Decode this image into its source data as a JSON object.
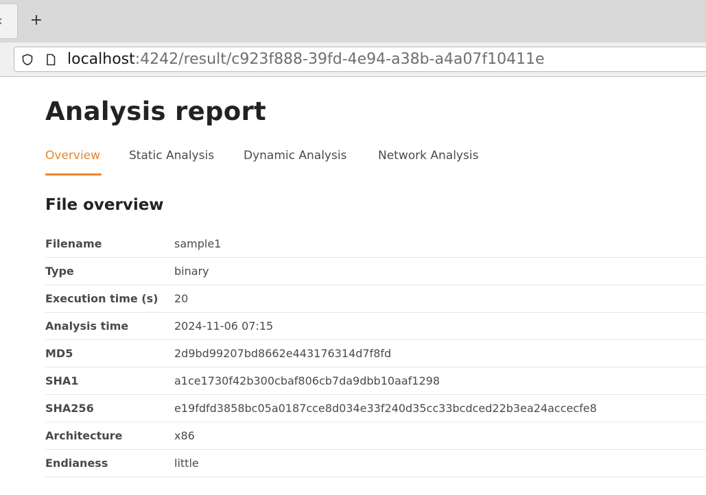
{
  "browser": {
    "tab_close_glyph": "×",
    "new_tab_glyph": "+",
    "url_host": "localhost",
    "url_path": ":4242/result/c923f888-39fd-4e94-a38b-a4a07f10411e",
    "icons": [
      "shield-icon",
      "page-icon",
      "close-icon",
      "plus-icon"
    ]
  },
  "page": {
    "title": "Analysis report",
    "tabs": [
      {
        "label": "Overview",
        "active": true
      },
      {
        "label": "Static Analysis",
        "active": false
      },
      {
        "label": "Dynamic Analysis",
        "active": false
      },
      {
        "label": "Network Analysis",
        "active": false
      }
    ],
    "accent_color": "#e8852b",
    "section_title": "File overview",
    "overview": [
      {
        "label": "Filename",
        "value": "sample1"
      },
      {
        "label": "Type",
        "value": "binary"
      },
      {
        "label": "Execution time (s)",
        "value": "20"
      },
      {
        "label": "Analysis time",
        "value": "2024-11-06 07:15"
      },
      {
        "label": "MD5",
        "value": "2d9bd99207bd8662e443176314d7f8fd"
      },
      {
        "label": "SHA1",
        "value": "a1ce1730f42b300cbaf806cb7da9dbb10aaf1298"
      },
      {
        "label": "SHA256",
        "value": "e19fdfd3858bc05a0187cce8d034e33f240d35cc33bcdced22b3ea24accecfe8"
      },
      {
        "label": "Architecture",
        "value": "x86"
      },
      {
        "label": "Endianess",
        "value": "little"
      }
    ]
  }
}
